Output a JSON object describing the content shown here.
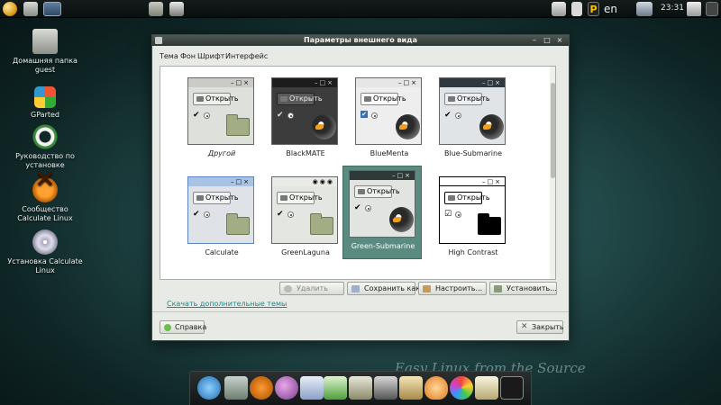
{
  "top_panel": {
    "icons": [
      "menu-icon",
      "home-folder-icon",
      "app-icon",
      "folder-icon",
      "screenshot-icon",
      "trash-icon",
      "clipboard-icon",
      "p-indicator-icon",
      "network-icon",
      "power-icon"
    ],
    "p_indicator": "P",
    "language": "en",
    "clock": "23:31"
  },
  "desktop": {
    "items": [
      {
        "label": "Домашняя папка guest",
        "icon": "home-folder-icon"
      },
      {
        "label": "GParted",
        "icon": "gparted-icon"
      },
      {
        "label": "Руководство по установке",
        "icon": "lifebuoy-icon"
      },
      {
        "label": "Сообщество Calculate Linux",
        "icon": "calculate-community-icon"
      },
      {
        "label": "Установка Calculate Linux",
        "icon": "install-disc-icon"
      }
    ]
  },
  "window": {
    "title": "Параметры внешнего вида",
    "controls": [
      "–",
      "□",
      "×"
    ],
    "tabs": [
      "Тема",
      "Фон",
      "Шрифт",
      "Интерфейс"
    ],
    "active_tab": "Тема",
    "themes": [
      {
        "name": "Другой",
        "preview_button": "Открыть",
        "selected": false
      },
      {
        "name": "BlackMATE",
        "preview_button": "Открыть",
        "selected": false
      },
      {
        "name": "BlueMenta",
        "preview_button": "Открыть",
        "selected": false
      },
      {
        "name": "Blue-Submarine",
        "preview_button": "Открыть",
        "selected": false
      },
      {
        "name": "Calculate",
        "preview_button": "Открыть",
        "selected": false
      },
      {
        "name": "GreenLaguna",
        "preview_button": "Открыть",
        "selected": false
      },
      {
        "name": "Green-Submarine",
        "preview_button": "Открыть",
        "selected": true
      },
      {
        "name": "High Contrast",
        "preview_button": "Открыть",
        "selected": false
      }
    ],
    "actions": {
      "delete": "Удалить",
      "save_as": "Сохранить как...",
      "configure": "Настроить...",
      "install": "Установить..."
    },
    "more_themes_link": "Скачать дополнительные темы",
    "help": "Справка",
    "close": "Закрыть"
  },
  "wallpaper_text": "Easy Linux from the Source",
  "dock": {
    "icons": [
      "browser-icon",
      "image-viewer-icon",
      "calculate-icon",
      "pidgin-icon",
      "writer-icon",
      "calc-spreadsheet-icon",
      "calculator-icon",
      "gimp-icon",
      "graphics-icon",
      "audio-player-icon",
      "preferences-icon",
      "text-editor-icon",
      "terminal-icon"
    ]
  },
  "colors": {
    "selection": "#5a8a80",
    "link": "#1b8a8a",
    "titlebar": "#3a4341"
  }
}
